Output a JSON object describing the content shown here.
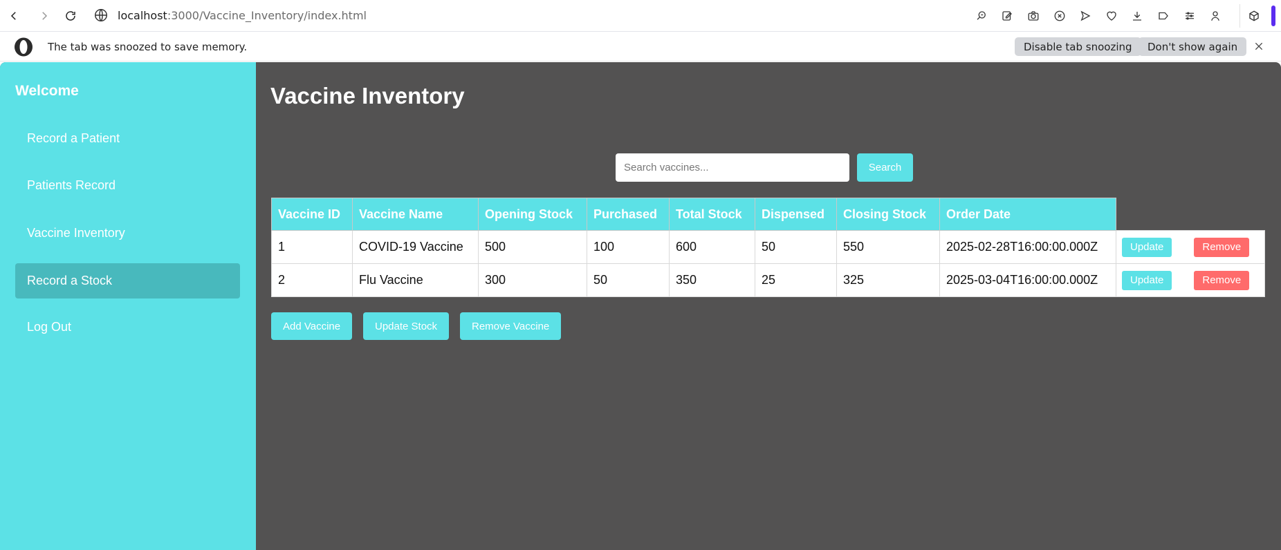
{
  "browser": {
    "url_host": "localhost",
    "url_path": ":3000/Vaccine_Inventory/index.html",
    "toolbar_icons": [
      "zoom-search-icon",
      "edit-icon",
      "camera-icon",
      "shield-x-icon",
      "send-icon",
      "heart-icon",
      "download-icon",
      "tab-icon",
      "sliders-icon",
      "user-icon"
    ],
    "extension_icon": "cube-icon",
    "accent_color": "#5b2cf0"
  },
  "infobar": {
    "message": "The tab was snoozed to save memory.",
    "disable_label": "Disable tab snoozing",
    "dont_show_label": "Don't show again"
  },
  "sidebar": {
    "welcome": "Welcome",
    "items": [
      {
        "label": "Record a Patient"
      },
      {
        "label": "Patients Record"
      },
      {
        "label": "Vaccine Inventory"
      },
      {
        "label": "Record a Stock",
        "active": true
      },
      {
        "label": "Log Out"
      }
    ]
  },
  "main": {
    "title": "Vaccine Inventory",
    "search_placeholder": "Search vaccines...",
    "search_label": "Search",
    "columns": [
      "Vaccine ID",
      "Vaccine Name",
      "Opening Stock",
      "Purchased",
      "Total Stock",
      "Dispensed",
      "Closing Stock",
      "Order Date"
    ],
    "rows": [
      [
        "1",
        "COVID-19 Vaccine",
        "500",
        "100",
        "600",
        "50",
        "550",
        "2025-02-28T16:00:00.000Z"
      ],
      [
        "2",
        "Flu Vaccine",
        "300",
        "50",
        "350",
        "25",
        "325",
        "2025-03-04T16:00:00.000Z"
      ]
    ],
    "update_label": "Update",
    "remove_label": "Remove",
    "add_label": "Add Vaccine",
    "update_stock_label": "Update Stock",
    "remove_vaccine_label": "Remove Vaccine"
  },
  "colors": {
    "accent": "#5ce1e6",
    "accent_active": "#48b9bd",
    "background": "#535252",
    "danger": "#ff6b6b"
  }
}
